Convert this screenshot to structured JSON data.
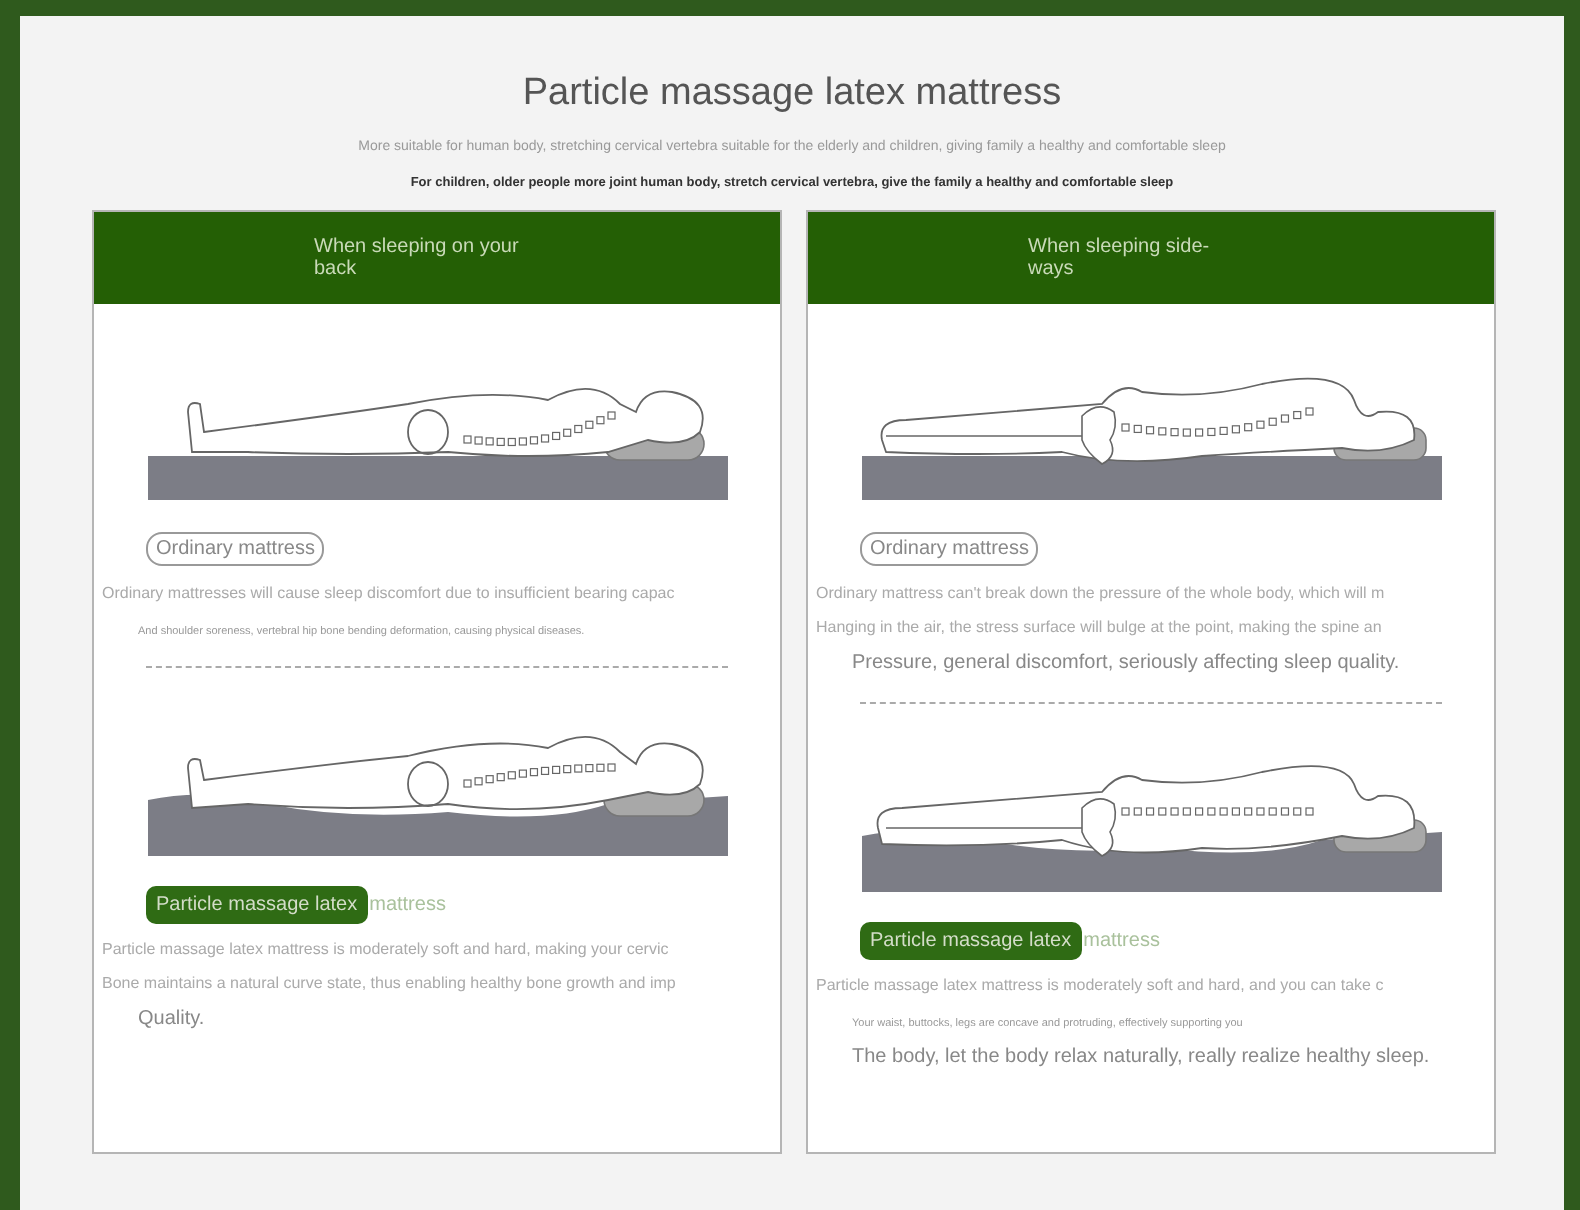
{
  "title": "Particle massage latex mattress",
  "subtitle": "More suitable for human body, stretching cervical vertebra suitable for the elderly and children, giving family a healthy and comfortable sleep",
  "tagline": "For children, older people more joint human body, stretch cervical vertebra, give the family a healthy and comfortable sleep",
  "panels": [
    {
      "header": "When sleeping on your back",
      "sections": [
        {
          "kind": "back-flat",
          "label": {
            "kind": "outlined",
            "text": "Ordinary mattress"
          },
          "lines": [
            {
              "text": "Ordinary mattresses will cause sleep discomfort due to insufficient bearing capac",
              "kind": "normal"
            },
            {
              "text": "And shoulder soreness, vertebral hip bone bending deformation, causing physical diseases.",
              "kind": "small"
            }
          ]
        },
        {
          "kind": "back-contour",
          "label": {
            "kind": "filled",
            "text": "Particle massage latex",
            "rest": "mattress"
          },
          "lines": [
            {
              "text": "Particle massage latex mattress is moderately soft and hard, making your cervic",
              "kind": "normal"
            },
            {
              "text": "Bone maintains a natural curve state, thus enabling healthy bone growth and imp",
              "kind": "normal"
            },
            {
              "text": "Quality.",
              "kind": "large"
            }
          ]
        }
      ]
    },
    {
      "header": "When sleeping side-ways",
      "sections": [
        {
          "kind": "side-flat",
          "label": {
            "kind": "outlined",
            "text": "Ordinary mattress"
          },
          "lines": [
            {
              "text": "Ordinary mattress can't break down the pressure of the whole body, which will m",
              "kind": "normal"
            },
            {
              "text": "Hanging in the air, the stress surface will bulge at the point, making the spine an",
              "kind": "normal"
            },
            {
              "text": "Pressure, general discomfort, seriously affecting sleep quality.",
              "kind": "large"
            }
          ]
        },
        {
          "kind": "side-contour",
          "label": {
            "kind": "filled",
            "text": "Particle massage latex",
            "rest": "mattress"
          },
          "lines": [
            {
              "text": "Particle massage latex mattress is moderately soft and hard, and you can take c",
              "kind": "normal"
            },
            {
              "text": "Your waist, buttocks, legs are concave and protruding, effectively supporting you",
              "kind": "small"
            },
            {
              "text": "The body, let the body relax naturally, really realize healthy sleep.",
              "kind": "large"
            }
          ]
        }
      ]
    }
  ]
}
